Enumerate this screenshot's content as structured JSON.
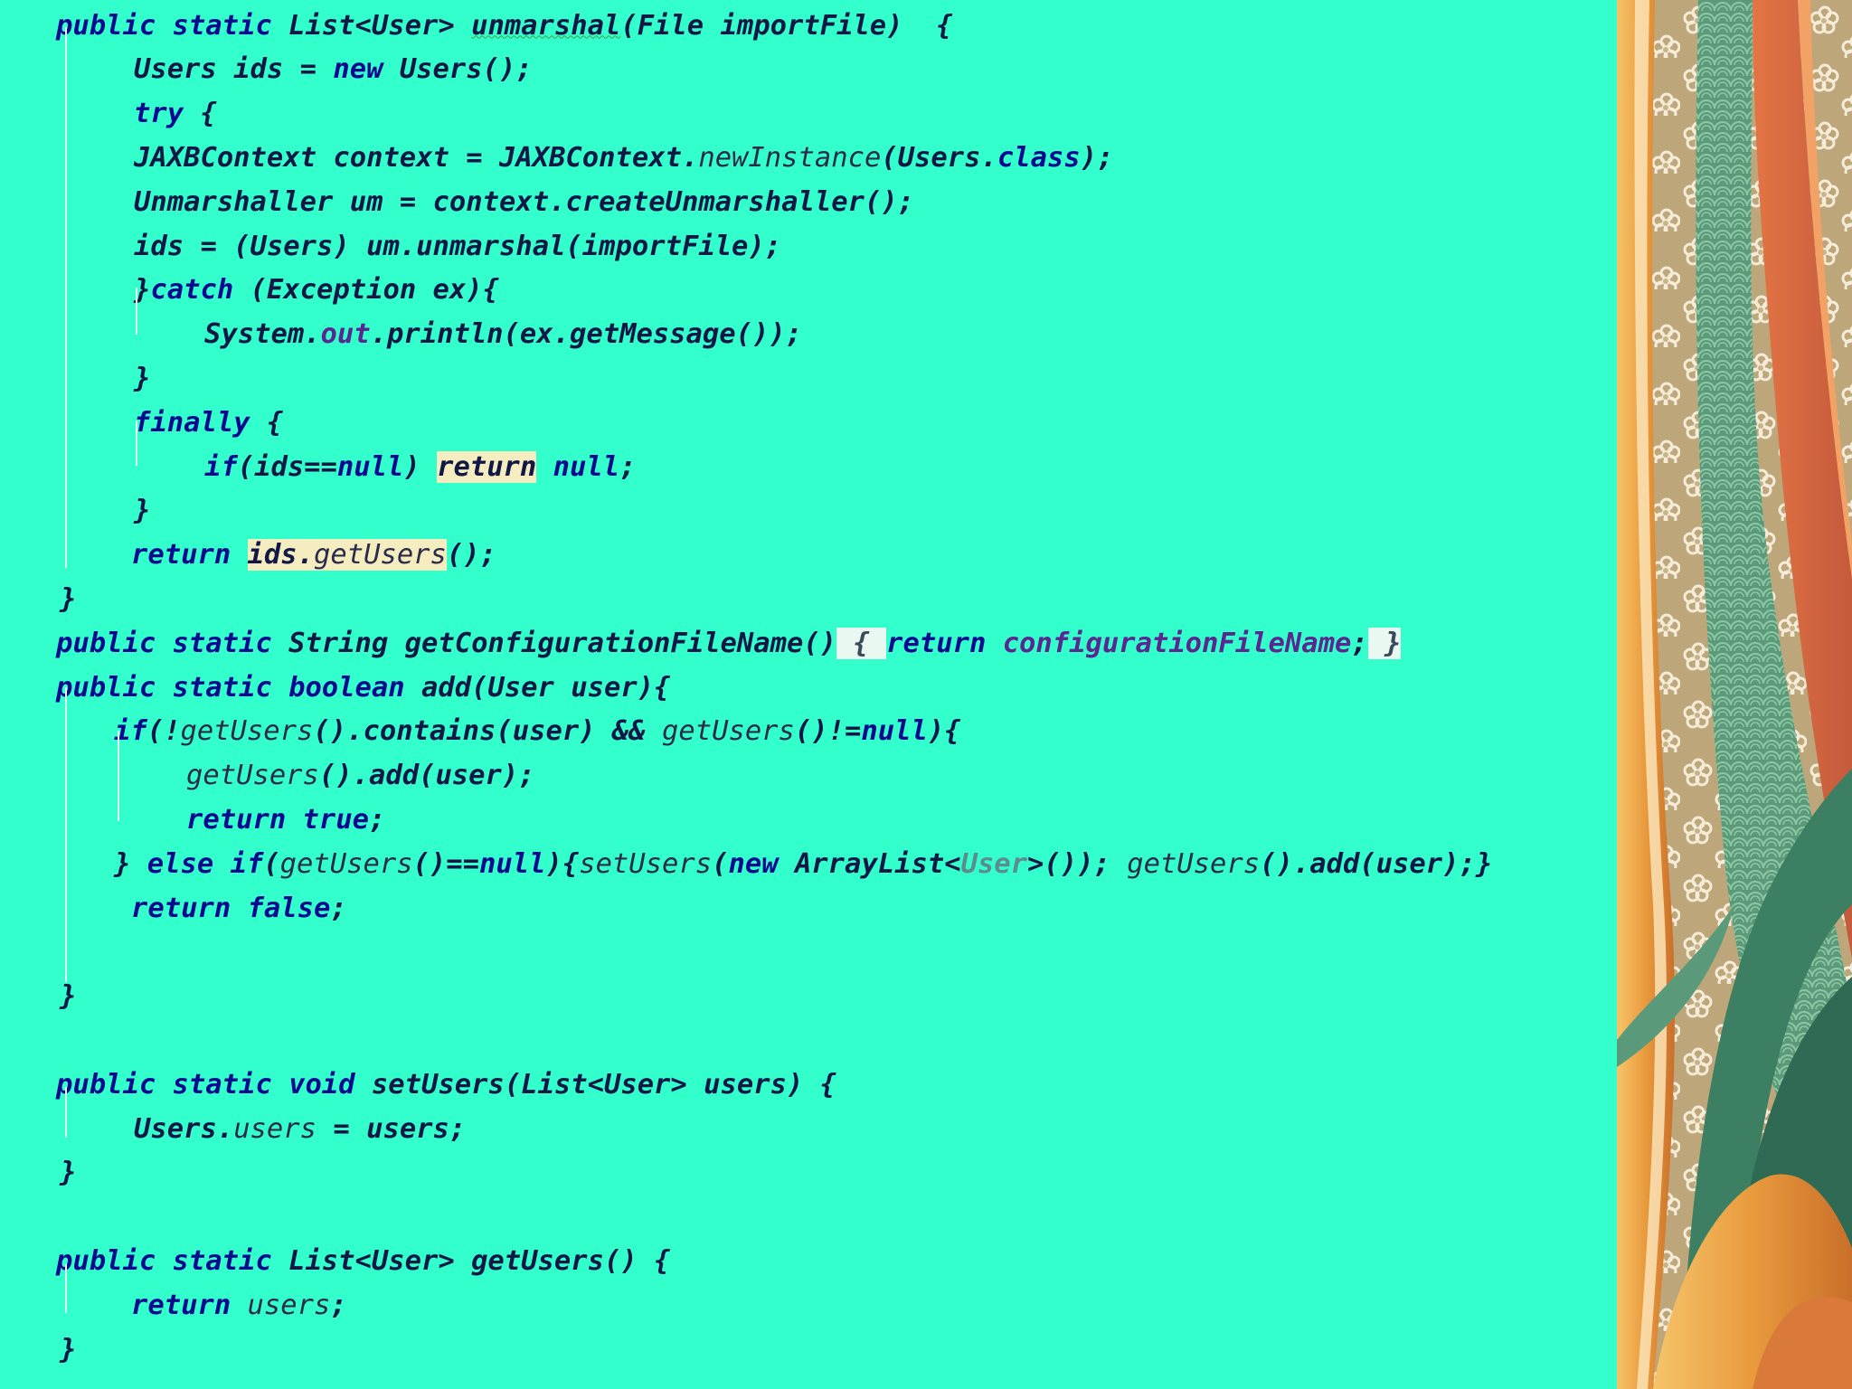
{
  "editor": {
    "lines": [
      [
        [
          "kw",
          "public static "
        ],
        [
          "t",
          "List<User> "
        ],
        [
          "sq",
          "unmarshal"
        ],
        [
          "t",
          "(File importFile)  {"
        ]
      ],
      [
        [
          "t",
          "Users ids = "
        ],
        [
          "kw",
          "new "
        ],
        [
          "t",
          "Users();"
        ]
      ],
      [
        [
          "kw",
          "try "
        ],
        [
          "t",
          "{"
        ]
      ],
      [
        [
          "t",
          "JAXBContext context = JAXBContext."
        ],
        [
          "m",
          "newInstance"
        ],
        [
          "t",
          "(Users."
        ],
        [
          "kw",
          "class"
        ],
        [
          "t",
          ");"
        ]
      ],
      [
        [
          "t",
          "Unmarshaller um = context.createUnmarshaller();"
        ]
      ],
      [
        [
          "t",
          "ids = (Users) um.unmarshal(importFile);"
        ]
      ],
      [
        [
          "t",
          "}"
        ],
        [
          "kw",
          "catch "
        ],
        [
          "t",
          "(Exception ex){"
        ]
      ],
      [
        [
          "t",
          "System."
        ],
        [
          "fld",
          "out"
        ],
        [
          "t",
          ".println(ex.getMessage());"
        ]
      ],
      [
        [
          "t",
          "}"
        ]
      ],
      [
        [
          "kw",
          "finally "
        ],
        [
          "t",
          "{"
        ]
      ],
      [
        [
          "kw",
          "if"
        ],
        [
          "t",
          "(ids=="
        ],
        [
          "kw",
          "null"
        ],
        [
          "t",
          ") "
        ],
        [
          "hl",
          "return"
        ],
        [
          "t",
          " "
        ],
        [
          "kw",
          "null"
        ],
        [
          "t",
          ";"
        ]
      ],
      [
        [
          "t",
          "}"
        ]
      ],
      [
        [
          "kw",
          "return "
        ],
        [
          "hl",
          "ids."
        ],
        [
          "hlm",
          "getUsers"
        ],
        [
          "t",
          "();"
        ]
      ],
      [
        [
          "t",
          "}"
        ]
      ],
      [
        [
          "kw",
          "public static "
        ],
        [
          "t",
          "String getConfigurationFileName()"
        ],
        [
          "hlb",
          " { "
        ],
        [
          "kw",
          "return "
        ],
        [
          "fld",
          "configurationFileName"
        ],
        [
          "t",
          ";"
        ],
        [
          "hlb",
          " }"
        ]
      ],
      [
        [
          "kw",
          "public static boolean "
        ],
        [
          "t",
          "add(User user){"
        ]
      ],
      [
        [
          "kw",
          "if"
        ],
        [
          "t",
          "(!"
        ],
        [
          "m",
          "getUsers"
        ],
        [
          "t",
          "().contains(user) && "
        ],
        [
          "m",
          "getUsers"
        ],
        [
          "t",
          "()!="
        ],
        [
          "kw",
          "null"
        ],
        [
          "t",
          "){"
        ]
      ],
      [
        [
          "m",
          "getUsers"
        ],
        [
          "t",
          "().add(user);"
        ]
      ],
      [
        [
          "kw",
          "return true"
        ],
        [
          "t",
          ";"
        ]
      ],
      [
        [
          "t",
          "} "
        ],
        [
          "kw",
          "else if"
        ],
        [
          "t",
          "("
        ],
        [
          "m",
          "getUsers"
        ],
        [
          "t",
          "()=="
        ],
        [
          "kw",
          "null"
        ],
        [
          "t",
          "){"
        ],
        [
          "m",
          "setUsers"
        ],
        [
          "t",
          "("
        ],
        [
          "kw",
          "new "
        ],
        [
          "t",
          "ArrayList<"
        ],
        [
          "gen",
          "User"
        ],
        [
          "t",
          ">()); "
        ],
        [
          "m",
          "getUsers"
        ],
        [
          "t",
          "().add(user);}"
        ]
      ],
      [
        [
          "kw",
          "return false"
        ],
        [
          "t",
          ";"
        ]
      ],
      [
        [
          "t",
          ""
        ]
      ],
      [
        [
          "t",
          "}"
        ]
      ],
      [
        [
          "t",
          ""
        ]
      ],
      [
        [
          "kw",
          "public static void "
        ],
        [
          "t",
          "setUsers(List<User> users) {"
        ]
      ],
      [
        [
          "t",
          "Users."
        ],
        [
          "fldm",
          "users"
        ],
        [
          "t",
          " = users;"
        ]
      ],
      [
        [
          "t",
          "}"
        ]
      ],
      [
        [
          "t",
          ""
        ]
      ],
      [
        [
          "kw",
          "public static "
        ],
        [
          "t",
          "List<User> getUsers() {"
        ]
      ],
      [
        [
          "kw",
          "return "
        ],
        [
          "fldm",
          "users"
        ],
        [
          "t",
          ";"
        ]
      ],
      [
        [
          "t",
          "}"
        ]
      ]
    ]
  }
}
